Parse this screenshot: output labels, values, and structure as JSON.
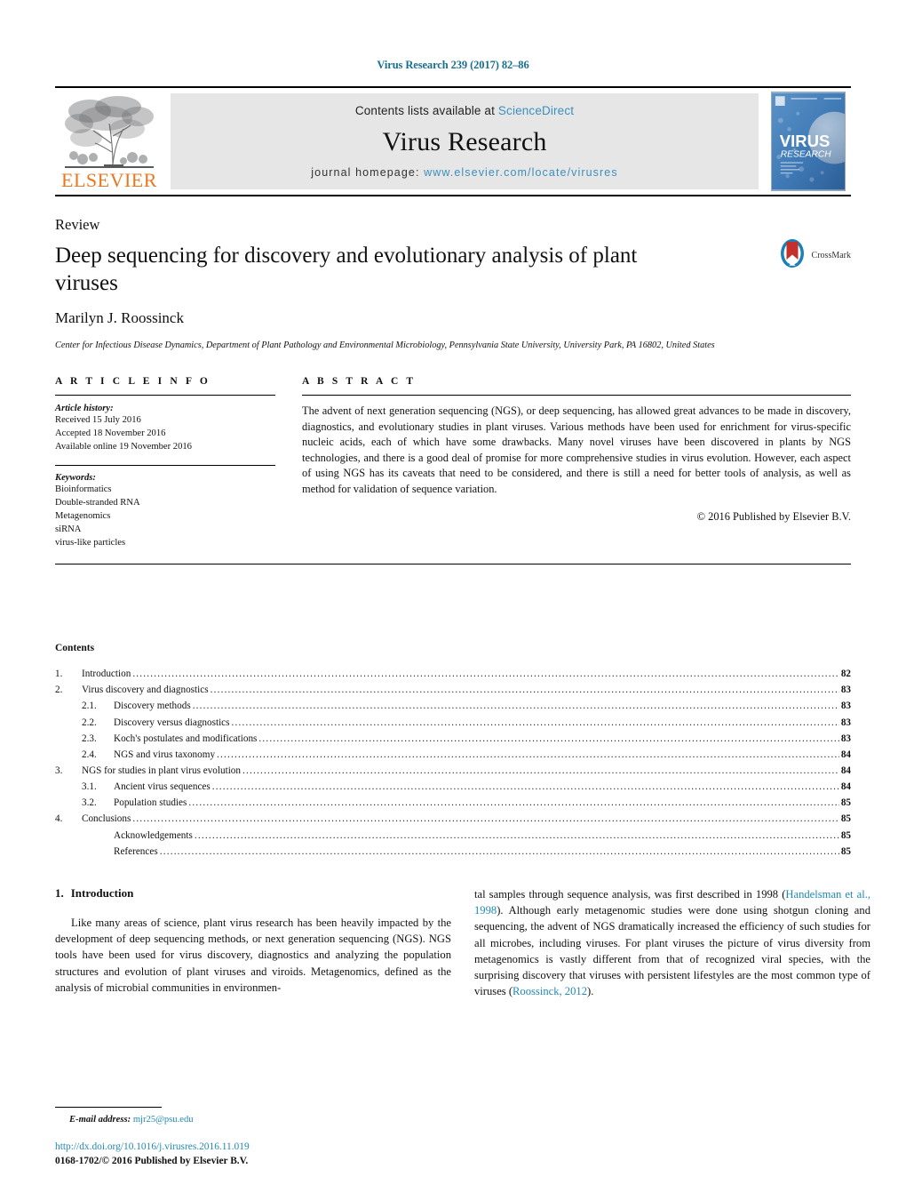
{
  "running_head": "Virus Research 239 (2017) 82–86",
  "masthead": {
    "publisher_word": "ELSEVIER",
    "contents_prefix": "Contents lists available at ",
    "contents_link": "ScienceDirect",
    "journal_name": "Virus Research",
    "homepage_prefix": "journal homepage: ",
    "homepage_url": "www.elsevier.com/locate/virusres",
    "cover_title": "VIRUS",
    "cover_subtitle": "RESEARCH"
  },
  "article": {
    "type_label": "Review",
    "title": "Deep sequencing for discovery and evolutionary analysis of plant viruses",
    "author": "Marilyn J. Roossinck",
    "affiliation": "Center for Infectious Disease Dynamics, Department of Plant Pathology and Environmental Microbiology, Pennsylvania State University, University Park, PA 16802, United States",
    "crossmark_label": "CrossMark"
  },
  "article_info": {
    "heading": "A R T I C L E   I N F O",
    "history_label": "Article history:",
    "history": [
      "Received 15 July 2016",
      "Accepted 18 November 2016",
      "Available online 19 November 2016"
    ],
    "keywords_label": "Keywords:",
    "keywords": [
      "Bioinformatics",
      "Double-stranded RNA",
      "Metagenomics",
      "siRNA",
      "virus-like particles"
    ]
  },
  "abstract": {
    "heading": "A B S T R A C T",
    "text": "The advent of next generation sequencing (NGS), or deep sequencing, has allowed great advances to be made in discovery, diagnostics, and evolutionary studies in plant viruses. Various methods have been used for enrichment for virus-specific nucleic acids, each of which have some drawbacks. Many novel viruses have been discovered in plants by NGS technologies, and there is a good deal of promise for more comprehensive studies in virus evolution. However, each aspect of using NGS has its caveats that need to be considered, and there is still a need for better tools of analysis, as well as method for validation of sequence variation.",
    "copyright": "© 2016 Published by Elsevier B.V."
  },
  "contents": {
    "heading": "Contents",
    "entries": [
      {
        "num": "1.",
        "sub": "",
        "label": "Introduction",
        "page": "82",
        "level": 1
      },
      {
        "num": "2.",
        "sub": "",
        "label": "Virus discovery and diagnostics",
        "page": "83",
        "level": 1
      },
      {
        "num": "",
        "sub": "2.1.",
        "label": "Discovery methods",
        "page": "83",
        "level": 2
      },
      {
        "num": "",
        "sub": "2.2.",
        "label": "Discovery versus diagnostics",
        "page": "83",
        "level": 2
      },
      {
        "num": "",
        "sub": "2.3.",
        "label": "Koch's postulates and modifications",
        "page": "83",
        "level": 2
      },
      {
        "num": "",
        "sub": "2.4.",
        "label": "NGS and virus taxonomy",
        "page": "84",
        "level": 2
      },
      {
        "num": "3.",
        "sub": "",
        "label": "NGS for studies in plant virus evolution",
        "page": "84",
        "level": 1
      },
      {
        "num": "",
        "sub": "3.1.",
        "label": "Ancient virus sequences",
        "page": "84",
        "level": 2
      },
      {
        "num": "",
        "sub": "3.2.",
        "label": "Population studies",
        "page": "85",
        "level": 2
      },
      {
        "num": "4.",
        "sub": "",
        "label": "Conclusions",
        "page": "85",
        "level": 1
      },
      {
        "num": "",
        "sub": "",
        "label": "Acknowledgements",
        "page": "85",
        "level": 2
      },
      {
        "num": "",
        "sub": "",
        "label": "References",
        "page": "85",
        "level": 2
      }
    ]
  },
  "introduction": {
    "heading_num": "1.",
    "heading_text": "Introduction",
    "left_paragraph": "Like many areas of science, plant virus research has been heavily impacted by the development of deep sequencing methods, or next generation sequencing (NGS). NGS tools have been used for virus discovery, diagnostics and analyzing the population structures and evolution of plant viruses and viroids. Metagenomics, defined as the analysis of microbial communities in environmen-",
    "right_part1": "tal samples through sequence analysis, was first described in 1998 (",
    "right_ref1": "Handelsman et al., 1998",
    "right_part2": "). Although early metagenomic studies were done using shotgun cloning and sequencing, the advent of NGS dramatically increased the efficiency of such studies for all microbes, including viruses. For plant viruses the picture of virus diversity from metagenomics is vastly different from that of recognized viral species, with the surprising discovery that viruses with persistent lifestyles are the most common type of viruses (",
    "right_ref2": "Roossinck, 2012",
    "right_part3": ")."
  },
  "footer": {
    "email_label": "E-mail address:",
    "email": "mjr25@psu.edu",
    "doi": "http://dx.doi.org/10.1016/j.virusres.2016.11.019",
    "issn_line": "0168-1702/© 2016 Published by Elsevier B.V."
  },
  "colors": {
    "link_blue": "#2089b5",
    "running_head_teal": "#186f8f",
    "elsevier_orange": "#E87722",
    "band_gray": "#e6e6e6",
    "crossmark_blue": "#1b7fba",
    "crossmark_red": "#c4302b"
  }
}
